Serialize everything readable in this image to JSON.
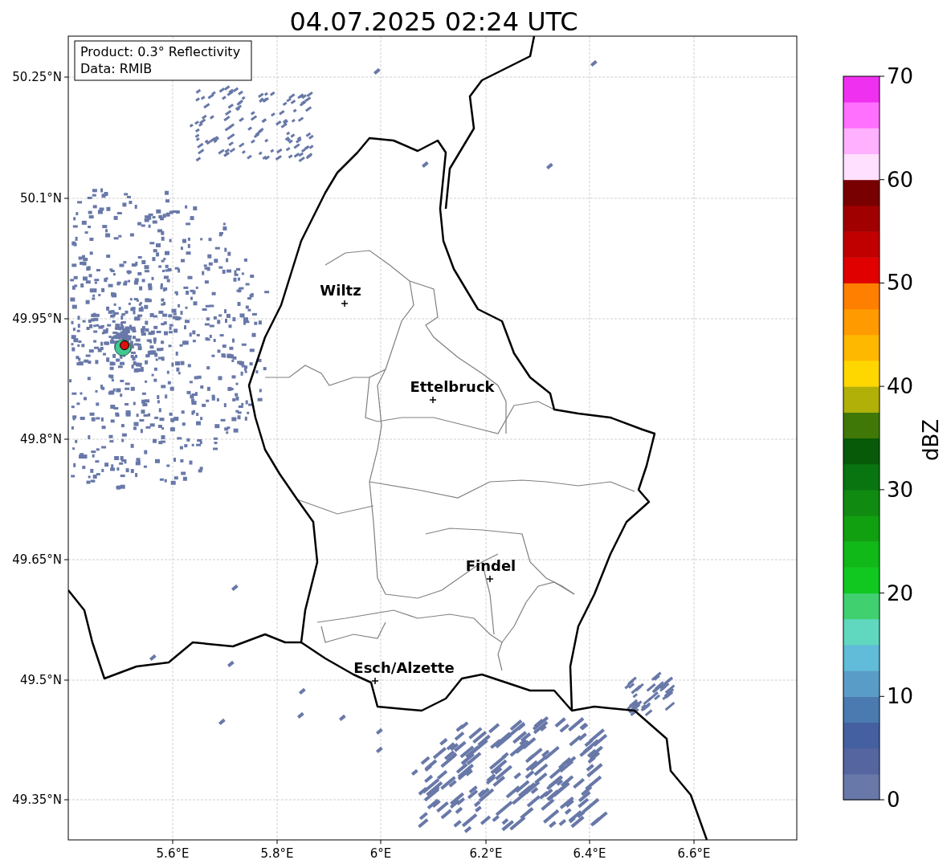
{
  "title": "04.07.2025 02:24 UTC",
  "info_box": [
    "Product: 0.3° Reflectivity",
    "Data: RMIB"
  ],
  "map": {
    "y_ticks": [
      "50.25°N",
      "50.1°N",
      "49.95°N",
      "49.8°N",
      "49.65°N",
      "49.5°N",
      "49.35°N"
    ],
    "x_ticks": [
      "5.6°E",
      "5.8°E",
      "6°E",
      "6.2°E",
      "6.4°E",
      "6.6°E"
    ],
    "places": [
      {
        "name": "Wiltz"
      },
      {
        "name": "Ettelbruck"
      },
      {
        "name": "Findel"
      },
      {
        "name": "Esch/Alzette"
      }
    ]
  },
  "colorbar": {
    "label": "dBZ",
    "ticks": [
      "70",
      "60",
      "50",
      "40",
      "30",
      "20",
      "10",
      "0"
    ],
    "bins": [
      {
        "color": "#6878a8"
      },
      {
        "color": "#5565a0"
      },
      {
        "color": "#4560a0"
      },
      {
        "color": "#4a7ab0"
      },
      {
        "color": "#5a9cc8"
      },
      {
        "color": "#60bcd8"
      },
      {
        "color": "#60d8c0"
      },
      {
        "color": "#40d070"
      },
      {
        "color": "#10c820"
      },
      {
        "color": "#10b818"
      },
      {
        "color": "#10a010"
      },
      {
        "color": "#108a10"
      },
      {
        "color": "#087510"
      },
      {
        "color": "#065a08"
      },
      {
        "color": "#407808"
      },
      {
        "color": "#b0b008"
      },
      {
        "color": "#ffd700"
      },
      {
        "color": "#ffb800"
      },
      {
        "color": "#ff9a00"
      },
      {
        "color": "#ff7f00"
      },
      {
        "color": "#e00000"
      },
      {
        "color": "#c00000"
      },
      {
        "color": "#a00000"
      },
      {
        "color": "#780000"
      },
      {
        "color": "#ffe0ff"
      },
      {
        "color": "#ffb0ff"
      },
      {
        "color": "#ff70ff"
      },
      {
        "color": "#f030f0"
      }
    ]
  }
}
